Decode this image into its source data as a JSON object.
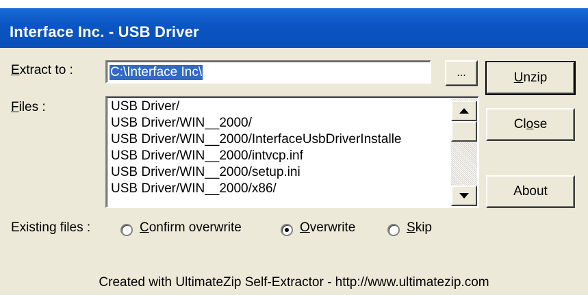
{
  "window": {
    "title": "Interface Inc. - USB Driver"
  },
  "extract": {
    "label": "Extract to :",
    "value": "C:\\Interface Inc\\",
    "browse_label": "..."
  },
  "files": {
    "label": "Files :",
    "items": [
      "USB Driver/",
      "USB Driver/WIN__2000/",
      "USB Driver/WIN__2000/InterfaceUsbDriverInstalle",
      "USB Driver/WIN__2000/intvcp.inf",
      "USB Driver/WIN__2000/setup.ini",
      "USB Driver/WIN__2000/x86/"
    ]
  },
  "buttons": {
    "unzip": "Unzip",
    "close": "Close",
    "about": "About"
  },
  "existing": {
    "label": "Existing files :",
    "options": [
      {
        "label": "Confirm overwrite",
        "checked": false
      },
      {
        "label": "Overwrite",
        "checked": true
      },
      {
        "label": "Skip",
        "checked": false
      }
    ]
  },
  "footer": "Created with UltimateZip Self-Extractor - http://www.ultimatezip.com",
  "icons": [
    "scroll-up-arrow-icon",
    "scroll-down-arrow-icon"
  ]
}
